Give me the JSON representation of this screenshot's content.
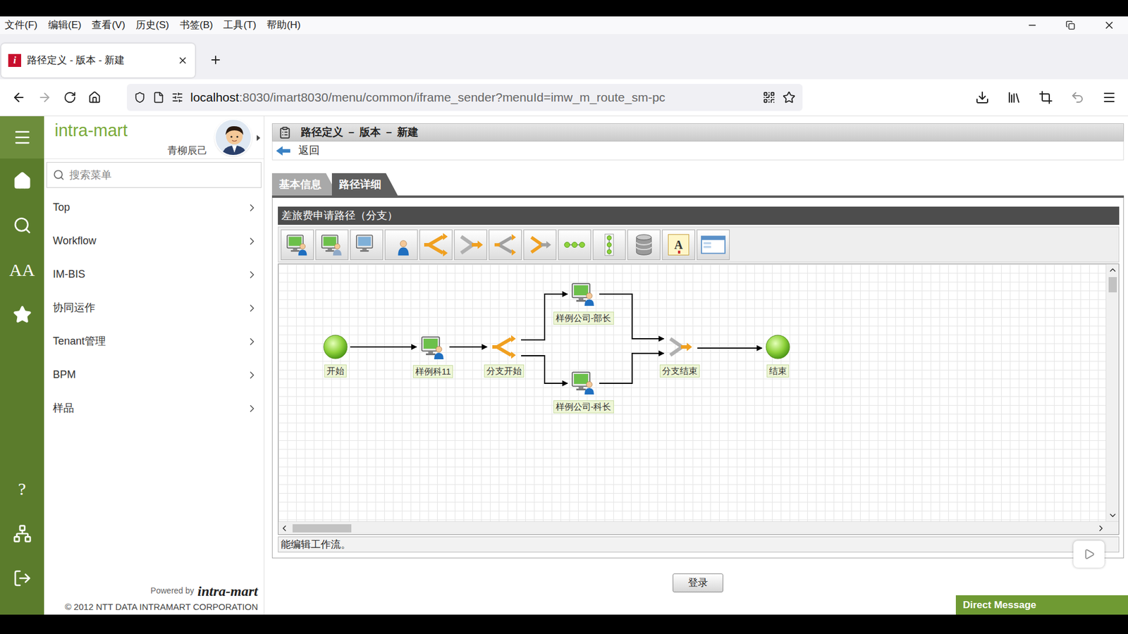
{
  "browser": {
    "menu": [
      "文件(F)",
      "编辑(E)",
      "查看(V)",
      "历史(S)",
      "书签(B)",
      "工具(T)",
      "帮助(H)"
    ],
    "tab": {
      "title": "路径定义 - 版本 - 新建",
      "favicon": "i"
    },
    "url": {
      "host": "localhost",
      "path": ":8030/imart8030/menu/common/iframe_sender?menuId=imw_m_route_sm-pc"
    }
  },
  "rail": [
    {
      "kind": "menu",
      "selected": true
    },
    {
      "kind": "home",
      "selected": false
    },
    {
      "kind": "search",
      "selected": false
    },
    {
      "kind": "font",
      "glyph": "AA",
      "selected": false
    },
    {
      "kind": "favorite",
      "selected": false
    },
    {
      "kind": "help",
      "glyph": "?",
      "selected": false
    },
    {
      "kind": "sitemap",
      "selected": false
    },
    {
      "kind": "logout",
      "selected": false
    }
  ],
  "sidebar": {
    "brand": "intra-mart",
    "user": "青柳辰己",
    "search_placeholder": "搜索菜单",
    "items": [
      "Top",
      "Workflow",
      "IM-BIS",
      "协同运作",
      "Tenant管理",
      "BPM",
      "样品"
    ],
    "powered_by": "Powered by",
    "logo": "intra-mart",
    "copyright": "© 2012 NTT DATA INTRAMART CORPORATION"
  },
  "page": {
    "title": "路径定义 － 版本 － 新建",
    "back": "返回",
    "tabs": [
      {
        "label": "基本信息",
        "selected": false
      },
      {
        "label": "路径详细",
        "selected": true
      }
    ],
    "editor": {
      "title": "差旅费申请路径（分支）",
      "toolbar": [
        {
          "kind": "task-user"
        },
        {
          "kind": "task-multi"
        },
        {
          "kind": "task-system"
        },
        {
          "kind": "user"
        },
        {
          "kind": "branch-start"
        },
        {
          "kind": "branch-end"
        },
        {
          "kind": "split"
        },
        {
          "kind": "join"
        },
        {
          "kind": "chain"
        },
        {
          "kind": "vertical"
        },
        {
          "kind": "database"
        },
        {
          "kind": "text",
          "glyph": "A"
        },
        {
          "kind": "window"
        }
      ],
      "nodes": [
        {
          "label": "开始",
          "kind": "start"
        },
        {
          "label": "样例科11",
          "kind": "task"
        },
        {
          "label": "分支开始",
          "kind": "branch-start"
        },
        {
          "label": "样例公司-部长",
          "kind": "task"
        },
        {
          "label": "样例公司-科长",
          "kind": "task"
        },
        {
          "label": "分支结束",
          "kind": "branch-end"
        },
        {
          "label": "结束",
          "kind": "end"
        }
      ],
      "status": "能编辑工作流。"
    },
    "submit": "登录"
  },
  "direct_message": "Direct Message"
}
